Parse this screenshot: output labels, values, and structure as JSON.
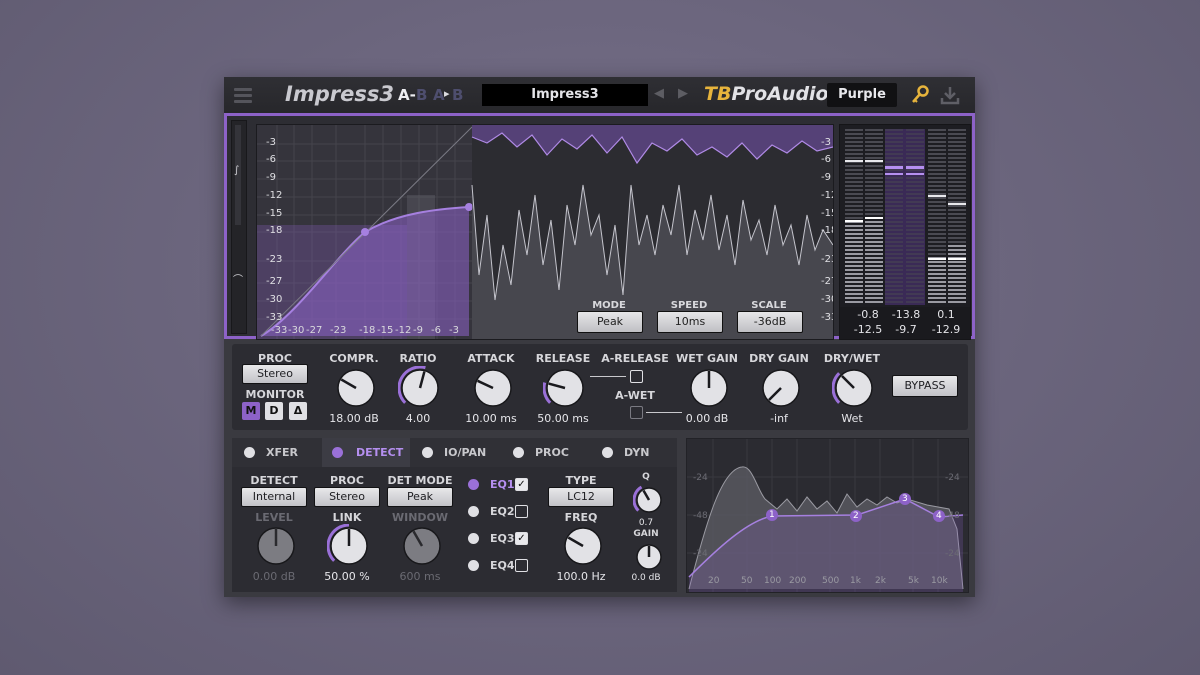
{
  "app": {
    "title": "Impress3",
    "ab_a": "A-",
    "ab_b1": "B",
    "ab_a2": "A",
    "ab_arrow": "▸",
    "ab_b2": "B",
    "preset": "Impress3",
    "brand_tb": "TB",
    "brand_rest": "ProAudio",
    "skin": "Purple",
    "accent": "#8d62c8",
    "brand_color": "#e7b43c"
  },
  "display": {
    "y_left": [
      "-3",
      "-6",
      "-9",
      "-12",
      "-15",
      "-18",
      "-23",
      "-27",
      "-30",
      "-33"
    ],
    "y_right": [
      "-3",
      "-6",
      "-9",
      "-12",
      "-15",
      "-18",
      "-23",
      "-27",
      "-30",
      "-33"
    ],
    "x_ticks": [
      "-33",
      "-30",
      "-27",
      "-23",
      "-18",
      "-15",
      "-12",
      "-9",
      "-6",
      "-3"
    ],
    "mode": {
      "label": "MODE",
      "value": "Peak"
    },
    "speed": {
      "label": "SPEED",
      "value": "10ms"
    },
    "scale": {
      "label": "SCALE",
      "value": "-36dB"
    }
  },
  "meters": {
    "row1": [
      "-0.8",
      "-13.8",
      "0.1"
    ],
    "row2": [
      "-12.5",
      "-9.7",
      "-12.9"
    ]
  },
  "controls": {
    "proc": {
      "label": "PROC",
      "value": "Stereo"
    },
    "monitor": {
      "label": "MONITOR",
      "m": "M",
      "d": "D",
      "delta": "Δ"
    },
    "compr": {
      "label": "COMPR.",
      "value": "18.00 dB"
    },
    "ratio": {
      "label": "RATIO",
      "value": "4.00"
    },
    "attack": {
      "label": "ATTACK",
      "value": "10.00 ms"
    },
    "release": {
      "label": "RELEASE",
      "value": "50.00 ms"
    },
    "a_release": {
      "label": "A-RELEASE"
    },
    "a_wet": {
      "label": "A-WET"
    },
    "wet_gain": {
      "label": "WET GAIN",
      "value": "0.00 dB"
    },
    "dry_gain": {
      "label": "DRY GAIN",
      "value": "-inf"
    },
    "dry_wet": {
      "label": "DRY/WET",
      "value": "Wet"
    },
    "bypass": {
      "label": "BYPASS"
    }
  },
  "tabs": [
    "XFER",
    "DETECT",
    "IO/PAN",
    "PROC",
    "DYN"
  ],
  "detect": {
    "detect": {
      "label": "DETECT",
      "value": "Internal"
    },
    "proc": {
      "label": "PROC",
      "value": "Stereo"
    },
    "det_mode": {
      "label": "DET MODE",
      "value": "Peak"
    },
    "level": {
      "label": "LEVEL",
      "value": "0.00 dB"
    },
    "link": {
      "label": "LINK",
      "value": "50.00 %"
    },
    "window": {
      "label": "WINDOW",
      "value": "600 ms"
    },
    "eqs": [
      "EQ1",
      "EQ2",
      "EQ3",
      "EQ4"
    ],
    "eq_checks": [
      "✓",
      "",
      "✓",
      ""
    ],
    "type": {
      "label": "TYPE",
      "value": "LC12"
    },
    "freq": {
      "label": "FREQ",
      "value": "100.0 Hz"
    },
    "q": {
      "label": "Q",
      "value": "0.7"
    },
    "gain": {
      "label": "GAIN",
      "value": "0.0 dB"
    }
  },
  "eq_display": {
    "x_ticks": [
      "20",
      "50",
      "100",
      "200",
      "500",
      "1k",
      "2k",
      "5k",
      "10k"
    ],
    "y_ticks": [
      "-24",
      "-48",
      "-24",
      "-24",
      "-48",
      "-24"
    ],
    "bands": [
      "1",
      "2",
      "3",
      "4"
    ]
  }
}
